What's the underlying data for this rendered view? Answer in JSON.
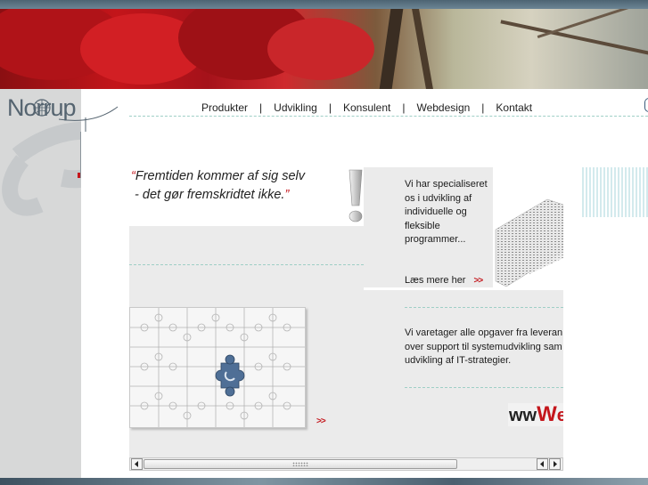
{
  "logo": {
    "text": "Norrup"
  },
  "nav": {
    "items": [
      {
        "label": "Produkter"
      },
      {
        "label": "Udvikling"
      },
      {
        "label": "Konsulent"
      },
      {
        "label": "Webdesign"
      },
      {
        "label": "Kontakt"
      }
    ],
    "separator": "|"
  },
  "quote": {
    "open_mark": "“",
    "line1": "Fremtiden kommer af sig selv",
    "line2": " - det gør fremskridtet ikke.",
    "close_mark": "”"
  },
  "specialized": {
    "lines": [
      "Vi har specialiseret",
      "os i udvikling af",
      "individuelle og",
      "fleksible",
      "programmer..."
    ],
    "read_more": "Læs mere her",
    "arrow": ">>"
  },
  "tasks": {
    "lines": [
      "Vi varetager alle opgaver fra leveran",
      "over support til systemudvikling sam",
      "udvikling af IT-strategier."
    ]
  },
  "puzzle": {
    "arrow": ">>"
  },
  "www_logo": {
    "text": "wwWe"
  },
  "colors": {
    "accent_red": "#c4161c",
    "strip_grey": "#d7d8d8",
    "panel_grey": "#ebebeb",
    "dotted_teal": "#9fcfc6"
  }
}
